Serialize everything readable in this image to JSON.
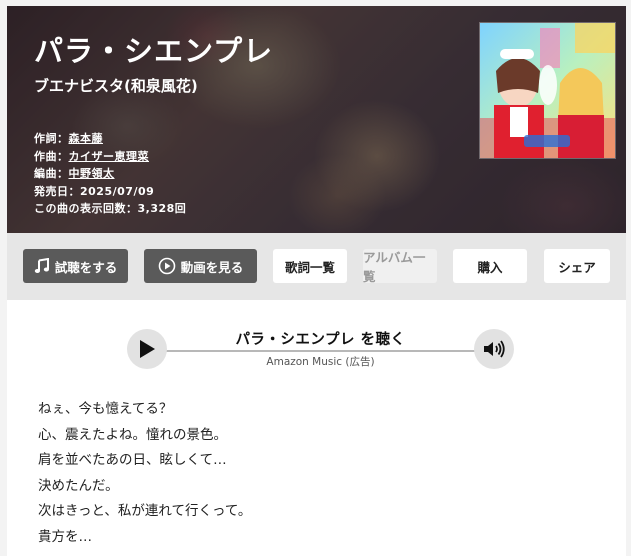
{
  "song": {
    "title": "パラ・シエンプレ",
    "artist": "ブエナビスタ(和泉風花)"
  },
  "credits": [
    {
      "label": "作詞：",
      "value": "森本藤"
    },
    {
      "label": "作曲：",
      "value": "カイザー恵理菜"
    },
    {
      "label": "編曲：",
      "value": "中野領太"
    }
  ],
  "release": {
    "label": "発売日：",
    "value": "2025/07/09"
  },
  "views": {
    "label": "この曲の表示回数：",
    "value": "3,328回"
  },
  "actions": {
    "listen": "試聴をする",
    "video": "動画を見る",
    "lyrics_list": "歌詞一覧",
    "album_list": "アルバム一覧",
    "buy": "購入",
    "share": "シェア"
  },
  "player": {
    "label": "パラ・シエンプレ を聴く",
    "source": "Amazon Music (広告)"
  },
  "lyrics": [
    "ねぇ、今も憶えてる？",
    "心、震えたよね。憧れの景色。",
    "肩を並べたあの日、眩しくて…",
    "決めたんだ。",
    "次はきっと、私が連れて行くって。",
    "貴方を…"
  ]
}
